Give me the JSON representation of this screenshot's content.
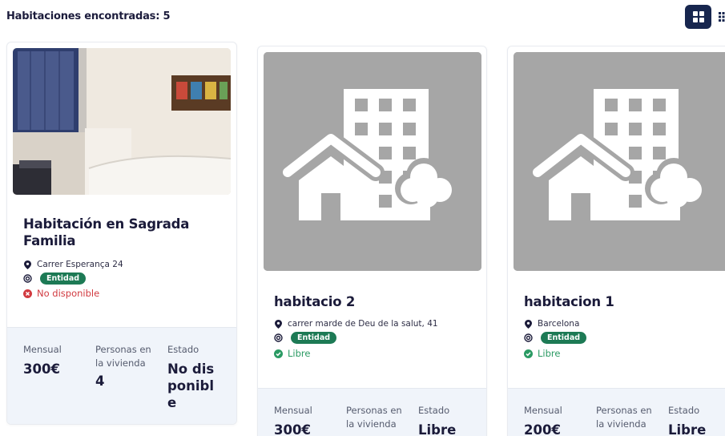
{
  "results": {
    "label": "Habitaciones encontradas: 5"
  },
  "view_toggle": {
    "grid_icon": "grid-large-icon",
    "list_icon": "grid-small-icon",
    "active_color": "#17264e"
  },
  "colors": {
    "badge": "#1d7a55",
    "unavailable": "#d13a40",
    "free": "#2a9a63",
    "footer_bg": "#f0f4fa",
    "placeholder_bg": "#a6a6a6"
  },
  "cards": [
    {
      "title": "Habitación en Sagrada Familia",
      "address": "Carrer Esperança 24",
      "badge": "Entidad",
      "status": "No disponible",
      "status_type": "unavailable",
      "image": "bedroom-photo",
      "stats": {
        "monthly_label": "Mensual",
        "monthly_value": "300€",
        "persons_label": "Personas en la vivienda",
        "persons_value": "4",
        "state_label": "Estado",
        "state_value": "No disponible"
      }
    },
    {
      "title": "habitacio 2",
      "address": "carrer marde de Deu de la salut, 41",
      "badge": "Entidad",
      "status": "Libre",
      "status_type": "free",
      "image": "building-placeholder-icon",
      "stats": {
        "monthly_label": "Mensual",
        "monthly_value": "300€",
        "persons_label": "Personas en la vivienda",
        "state_label": "Estado",
        "state_value": "Libre"
      }
    },
    {
      "title": "habitacion 1",
      "address": "Barcelona",
      "badge": "Entidad",
      "status": "Libre",
      "status_type": "free",
      "image": "building-placeholder-icon",
      "stats": {
        "monthly_label": "Mensual",
        "monthly_value": "200€",
        "persons_label": "Personas en la vivienda",
        "state_label": "Estado",
        "state_value": "Libre"
      }
    }
  ]
}
